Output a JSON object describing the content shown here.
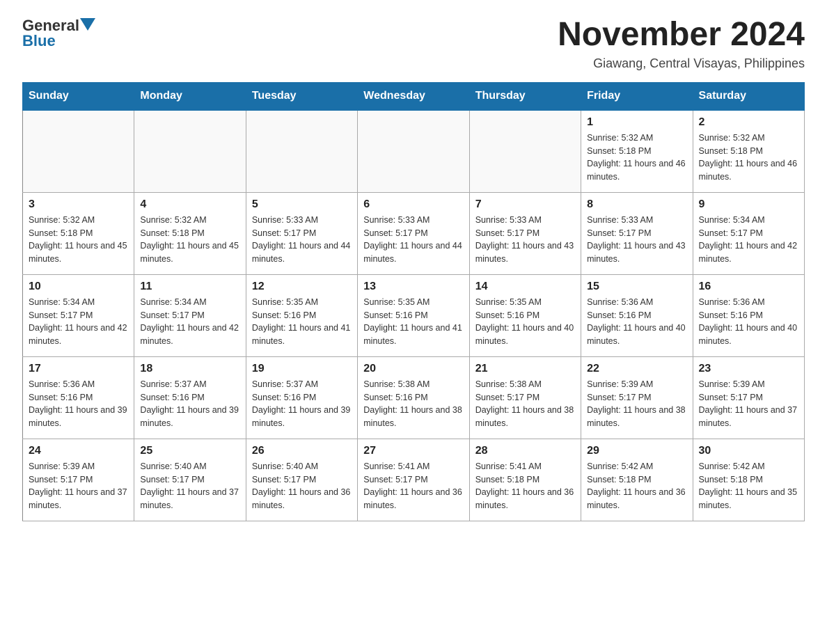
{
  "header": {
    "logo_general": "General",
    "logo_blue": "Blue",
    "month_title": "November 2024",
    "location": "Giawang, Central Visayas, Philippines"
  },
  "weekdays": [
    "Sunday",
    "Monday",
    "Tuesday",
    "Wednesday",
    "Thursday",
    "Friday",
    "Saturday"
  ],
  "weeks": [
    [
      {
        "day": "",
        "info": ""
      },
      {
        "day": "",
        "info": ""
      },
      {
        "day": "",
        "info": ""
      },
      {
        "day": "",
        "info": ""
      },
      {
        "day": "",
        "info": ""
      },
      {
        "day": "1",
        "info": "Sunrise: 5:32 AM\nSunset: 5:18 PM\nDaylight: 11 hours and 46 minutes."
      },
      {
        "day": "2",
        "info": "Sunrise: 5:32 AM\nSunset: 5:18 PM\nDaylight: 11 hours and 46 minutes."
      }
    ],
    [
      {
        "day": "3",
        "info": "Sunrise: 5:32 AM\nSunset: 5:18 PM\nDaylight: 11 hours and 45 minutes."
      },
      {
        "day": "4",
        "info": "Sunrise: 5:32 AM\nSunset: 5:18 PM\nDaylight: 11 hours and 45 minutes."
      },
      {
        "day": "5",
        "info": "Sunrise: 5:33 AM\nSunset: 5:17 PM\nDaylight: 11 hours and 44 minutes."
      },
      {
        "day": "6",
        "info": "Sunrise: 5:33 AM\nSunset: 5:17 PM\nDaylight: 11 hours and 44 minutes."
      },
      {
        "day": "7",
        "info": "Sunrise: 5:33 AM\nSunset: 5:17 PM\nDaylight: 11 hours and 43 minutes."
      },
      {
        "day": "8",
        "info": "Sunrise: 5:33 AM\nSunset: 5:17 PM\nDaylight: 11 hours and 43 minutes."
      },
      {
        "day": "9",
        "info": "Sunrise: 5:34 AM\nSunset: 5:17 PM\nDaylight: 11 hours and 42 minutes."
      }
    ],
    [
      {
        "day": "10",
        "info": "Sunrise: 5:34 AM\nSunset: 5:17 PM\nDaylight: 11 hours and 42 minutes."
      },
      {
        "day": "11",
        "info": "Sunrise: 5:34 AM\nSunset: 5:17 PM\nDaylight: 11 hours and 42 minutes."
      },
      {
        "day": "12",
        "info": "Sunrise: 5:35 AM\nSunset: 5:16 PM\nDaylight: 11 hours and 41 minutes."
      },
      {
        "day": "13",
        "info": "Sunrise: 5:35 AM\nSunset: 5:16 PM\nDaylight: 11 hours and 41 minutes."
      },
      {
        "day": "14",
        "info": "Sunrise: 5:35 AM\nSunset: 5:16 PM\nDaylight: 11 hours and 40 minutes."
      },
      {
        "day": "15",
        "info": "Sunrise: 5:36 AM\nSunset: 5:16 PM\nDaylight: 11 hours and 40 minutes."
      },
      {
        "day": "16",
        "info": "Sunrise: 5:36 AM\nSunset: 5:16 PM\nDaylight: 11 hours and 40 minutes."
      }
    ],
    [
      {
        "day": "17",
        "info": "Sunrise: 5:36 AM\nSunset: 5:16 PM\nDaylight: 11 hours and 39 minutes."
      },
      {
        "day": "18",
        "info": "Sunrise: 5:37 AM\nSunset: 5:16 PM\nDaylight: 11 hours and 39 minutes."
      },
      {
        "day": "19",
        "info": "Sunrise: 5:37 AM\nSunset: 5:16 PM\nDaylight: 11 hours and 39 minutes."
      },
      {
        "day": "20",
        "info": "Sunrise: 5:38 AM\nSunset: 5:16 PM\nDaylight: 11 hours and 38 minutes."
      },
      {
        "day": "21",
        "info": "Sunrise: 5:38 AM\nSunset: 5:17 PM\nDaylight: 11 hours and 38 minutes."
      },
      {
        "day": "22",
        "info": "Sunrise: 5:39 AM\nSunset: 5:17 PM\nDaylight: 11 hours and 38 minutes."
      },
      {
        "day": "23",
        "info": "Sunrise: 5:39 AM\nSunset: 5:17 PM\nDaylight: 11 hours and 37 minutes."
      }
    ],
    [
      {
        "day": "24",
        "info": "Sunrise: 5:39 AM\nSunset: 5:17 PM\nDaylight: 11 hours and 37 minutes."
      },
      {
        "day": "25",
        "info": "Sunrise: 5:40 AM\nSunset: 5:17 PM\nDaylight: 11 hours and 37 minutes."
      },
      {
        "day": "26",
        "info": "Sunrise: 5:40 AM\nSunset: 5:17 PM\nDaylight: 11 hours and 36 minutes."
      },
      {
        "day": "27",
        "info": "Sunrise: 5:41 AM\nSunset: 5:17 PM\nDaylight: 11 hours and 36 minutes."
      },
      {
        "day": "28",
        "info": "Sunrise: 5:41 AM\nSunset: 5:18 PM\nDaylight: 11 hours and 36 minutes."
      },
      {
        "day": "29",
        "info": "Sunrise: 5:42 AM\nSunset: 5:18 PM\nDaylight: 11 hours and 36 minutes."
      },
      {
        "day": "30",
        "info": "Sunrise: 5:42 AM\nSunset: 5:18 PM\nDaylight: 11 hours and 35 minutes."
      }
    ]
  ]
}
